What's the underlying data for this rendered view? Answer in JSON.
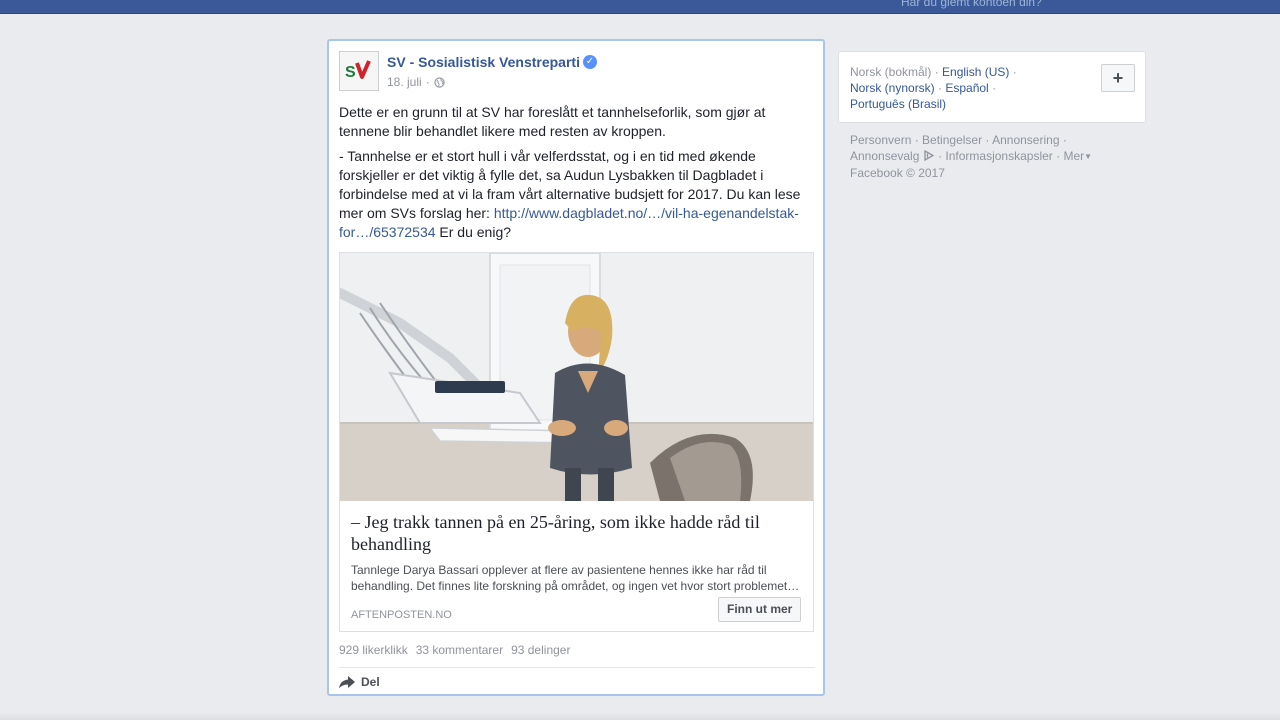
{
  "header": {
    "forgot_account": "Har du glemt kontoen din?"
  },
  "post": {
    "page_name": "SV - Sosialistisk Venstreparti",
    "verified_icon": "verified-check-icon",
    "date": "18. juli",
    "separator": "·",
    "privacy_icon": "globe-icon",
    "paragraph1": "Dette er en grunn til at SV har foreslått et tannhelseforlik, som gjør at tennene blir behandlet likere med resten av kroppen.",
    "paragraph2_text": "- Tannhelse er et stort hull i vår velferdsstat, og i en tid med økende forskjeller er det viktig å fylle det, sa Audun Lysbakken til Dagbladet i forbindelse med at vi la fram vårt alternative budsjett for 2017. Du kan lese mer om SVs forslag her: ",
    "paragraph2_link": "http://www.dagbladet.no/…/vil-ha-egenandelstak-for…/65372534",
    "paragraph2_tail": " Er du enig?",
    "link_card": {
      "title": "– Jeg trakk tannen på en 25-åring, som ikke hadde råd til behandling",
      "description": "Tannlege Darya Bassari opplever at flere av pasientene hennes ikke har råd til behandling. Det finnes lite forskning på området, og ingen vet hvor stort problemet…",
      "source": "AFTENPOSTEN.NO",
      "cta": "Finn ut mer"
    },
    "stats": {
      "likes": "929 likerklikk",
      "comments": "33 kommentarer",
      "shares": "93 delinger"
    },
    "share_label": "Del"
  },
  "sidebar": {
    "languages": {
      "current": "Norsk (bokmål)",
      "options": [
        "English (US)",
        "Norsk (nynorsk)",
        "Español",
        "Português (Brasil)"
      ],
      "add_label": "+"
    },
    "footer": {
      "links": [
        "Personvern",
        "Betingelser",
        "Annonsering",
        "Annonsevalg",
        "Informasjonskapsler",
        "Mer"
      ],
      "copyright": "Facebook © 2017"
    }
  },
  "colors": {
    "brand_blue": "#3b5998",
    "link_blue": "#365899",
    "page_bg": "#e9ebee",
    "highlight_border": "#a8c5ef"
  }
}
